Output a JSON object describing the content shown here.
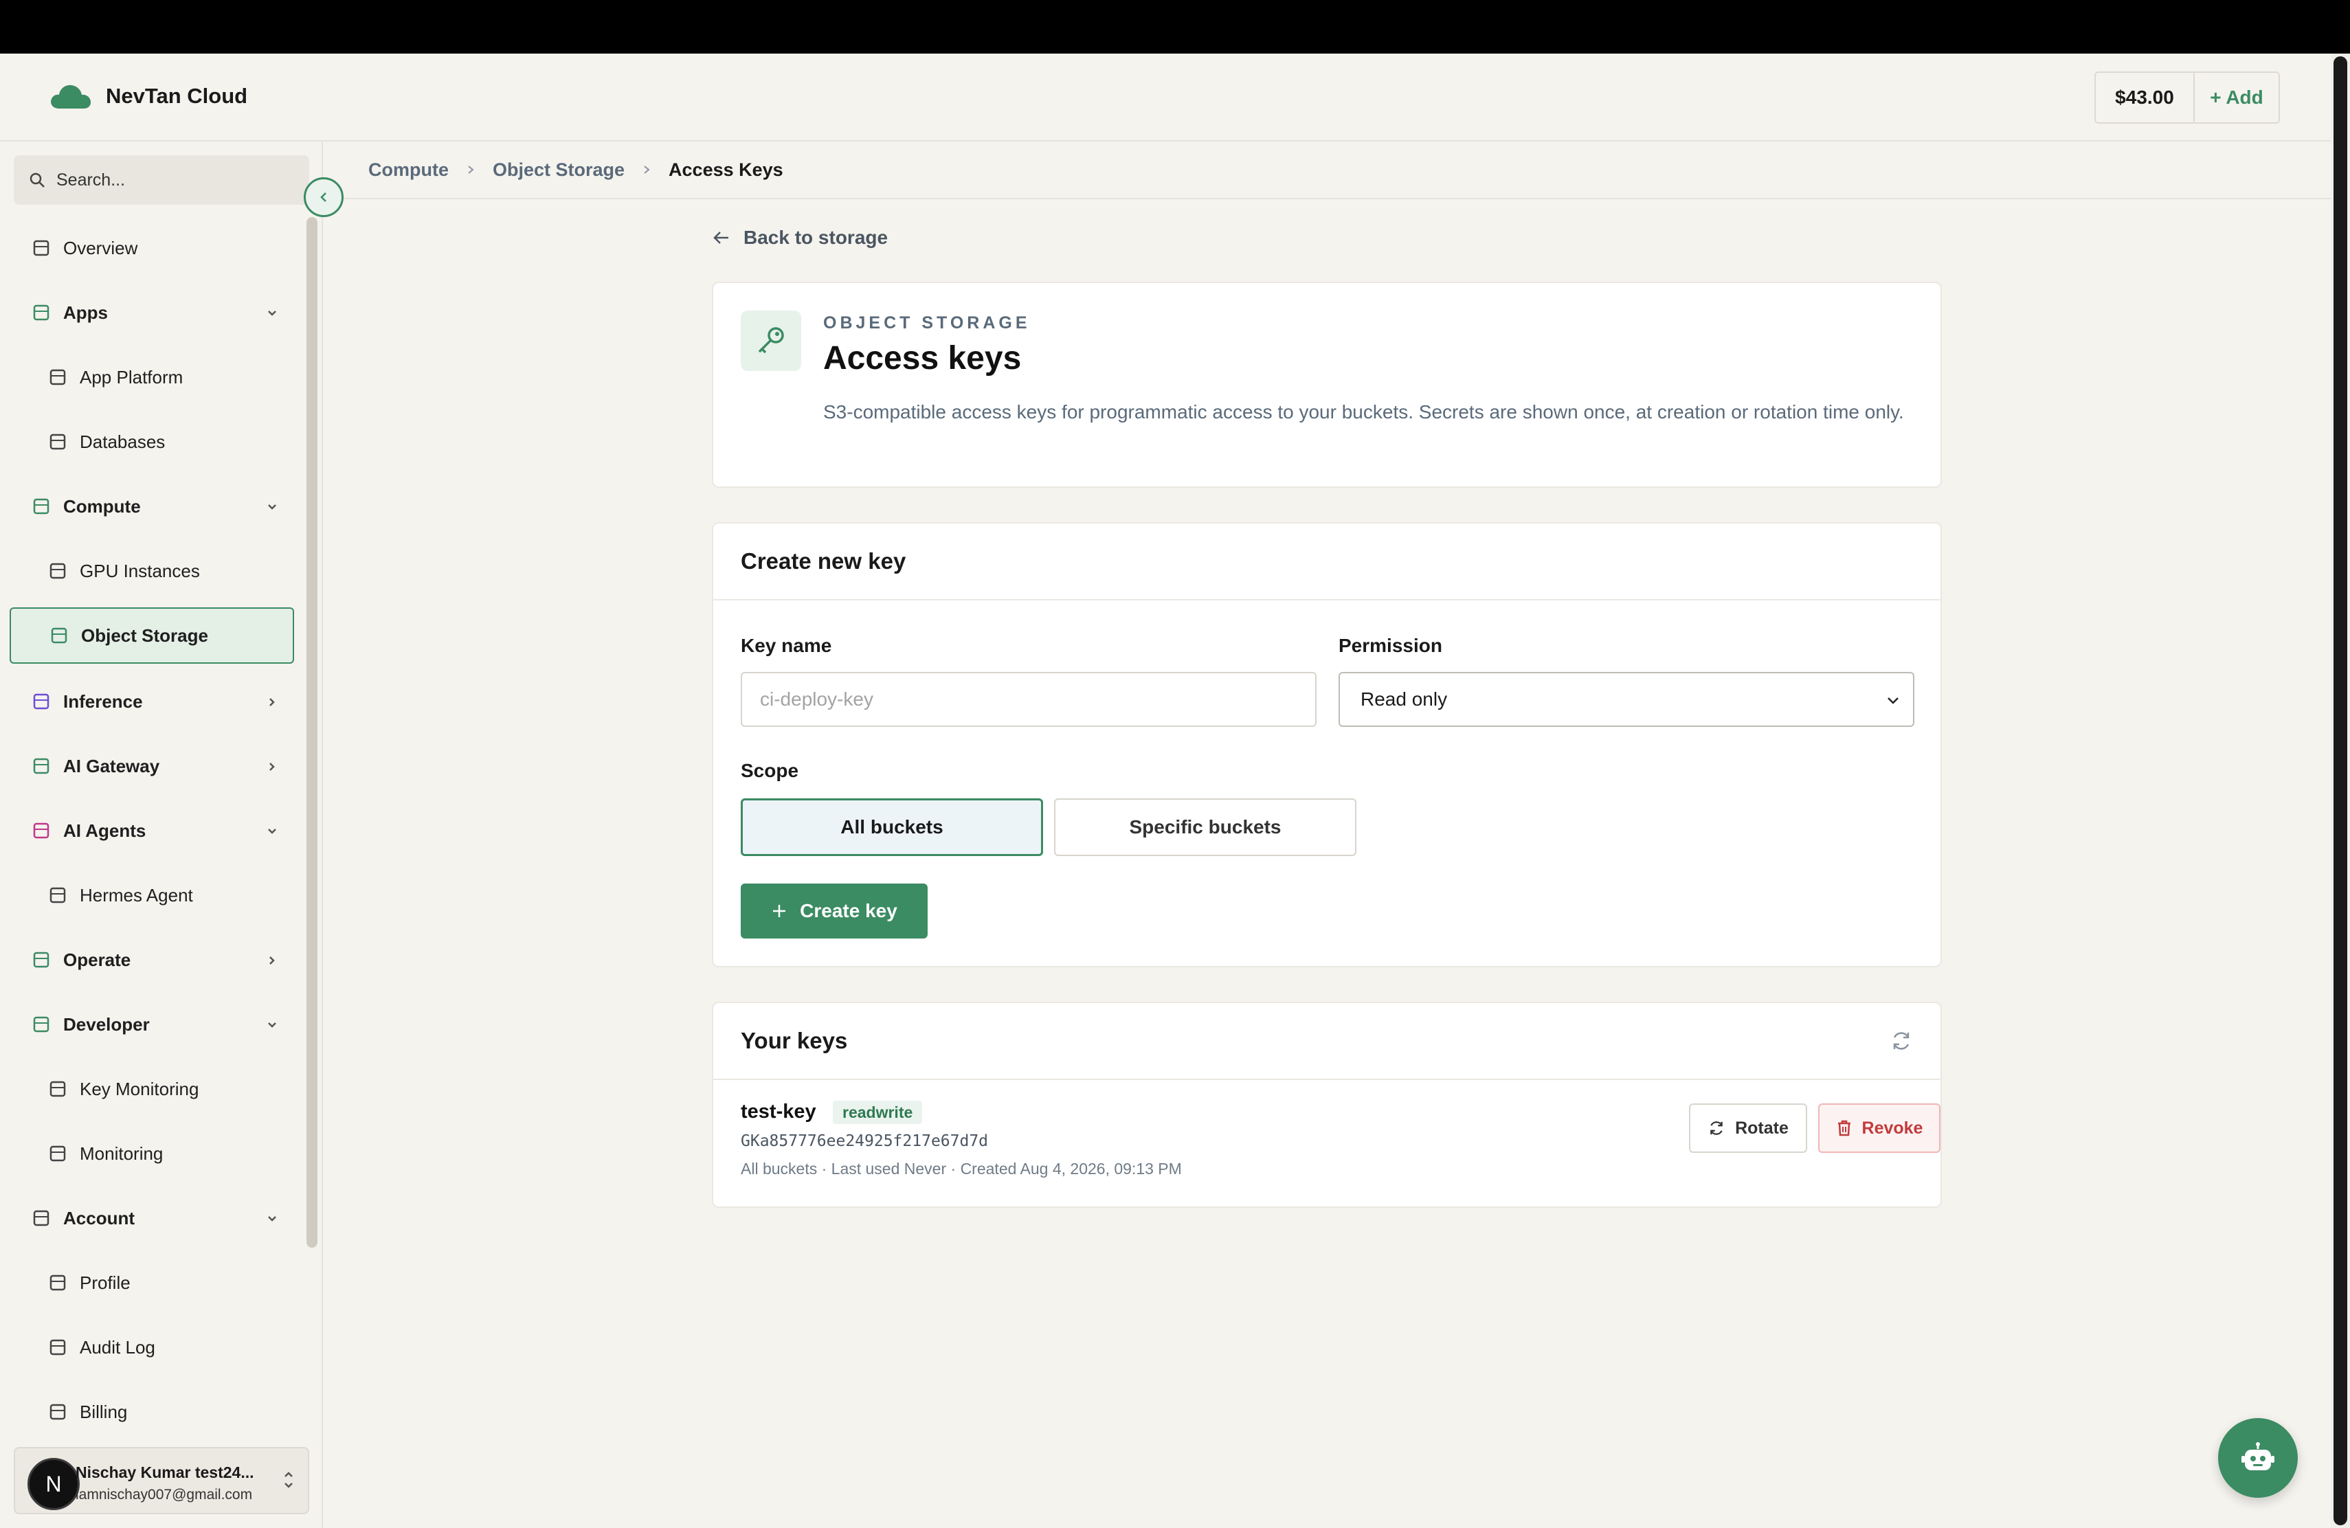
{
  "header": {
    "brand": "NevTan Cloud",
    "balance": "$43.00",
    "add_label": "+ Add"
  },
  "sidebar": {
    "search_placeholder": "Search...",
    "items": [
      {
        "label": "Overview",
        "icon": "layout-icon",
        "type": "top"
      },
      {
        "label": "Apps",
        "icon": "apps-icon",
        "type": "section",
        "chevron": "down"
      },
      {
        "label": "App Platform",
        "icon": "rocket-icon",
        "type": "sub"
      },
      {
        "label": "Databases",
        "icon": "database-icon",
        "type": "sub"
      },
      {
        "label": "Compute",
        "icon": "compute-icon",
        "type": "section",
        "chevron": "down"
      },
      {
        "label": "GPU Instances",
        "icon": "chip-icon",
        "type": "sub"
      },
      {
        "label": "Object Storage",
        "icon": "cloud-icon",
        "type": "sub",
        "active": true
      },
      {
        "label": "Inference",
        "icon": "bolt-icon",
        "type": "section",
        "chevron": "right"
      },
      {
        "label": "AI Gateway",
        "icon": "network-icon",
        "type": "section",
        "chevron": "right"
      },
      {
        "label": "AI Agents",
        "icon": "headset-icon",
        "type": "section",
        "chevron": "down"
      },
      {
        "label": "Hermes Agent",
        "icon": "robot-icon",
        "type": "sub"
      },
      {
        "label": "Operate",
        "icon": "grid-icon",
        "type": "section",
        "chevron": "right"
      },
      {
        "label": "Developer",
        "icon": "code-icon",
        "type": "section",
        "chevron": "down"
      },
      {
        "label": "Key Monitoring",
        "icon": "key-icon",
        "type": "sub"
      },
      {
        "label": "Monitoring",
        "icon": "chart-icon",
        "type": "sub"
      },
      {
        "label": "Account",
        "icon": "user-cog-icon",
        "type": "section",
        "chevron": "down"
      },
      {
        "label": "Profile",
        "icon": "user-circle-icon",
        "type": "sub"
      },
      {
        "label": "Audit Log",
        "icon": "log-icon",
        "type": "sub"
      },
      {
        "label": "Billing",
        "icon": "card-icon",
        "type": "sub"
      }
    ],
    "user": {
      "initial": "N",
      "name": "Nischay Kumar test24...",
      "email": "iamnischay007@gmail.com"
    }
  },
  "breadcrumb": [
    "Compute",
    "Object Storage",
    "Access Keys"
  ],
  "main": {
    "back_label": "Back to storage",
    "hero": {
      "eyebrow": "OBJECT STORAGE",
      "title": "Access keys",
      "description": "S3-compatible access keys for programmatic access to your buckets. Secrets are shown once, at creation or rotation time only."
    },
    "create": {
      "title": "Create new key",
      "key_name_label": "Key name",
      "key_name_placeholder": "ci-deploy-key",
      "permission_label": "Permission",
      "permission_value": "Read only",
      "scope_label": "Scope",
      "scope_all": "All buckets",
      "scope_specific": "Specific buckets",
      "create_button": "Create key"
    },
    "keys": {
      "title": "Your keys",
      "items": [
        {
          "name": "test-key",
          "permission": "readwrite",
          "id": "GKa857776ee24925f217e67d7d",
          "meta": "All buckets · Last used Never · Created Aug 4, 2026, 09:13 PM",
          "rotate_label": "Rotate",
          "revoke_label": "Revoke"
        }
      ]
    }
  },
  "colors": {
    "accent": "#3b8b63",
    "danger": "#c23b3b",
    "background": "#f5f3ee"
  }
}
